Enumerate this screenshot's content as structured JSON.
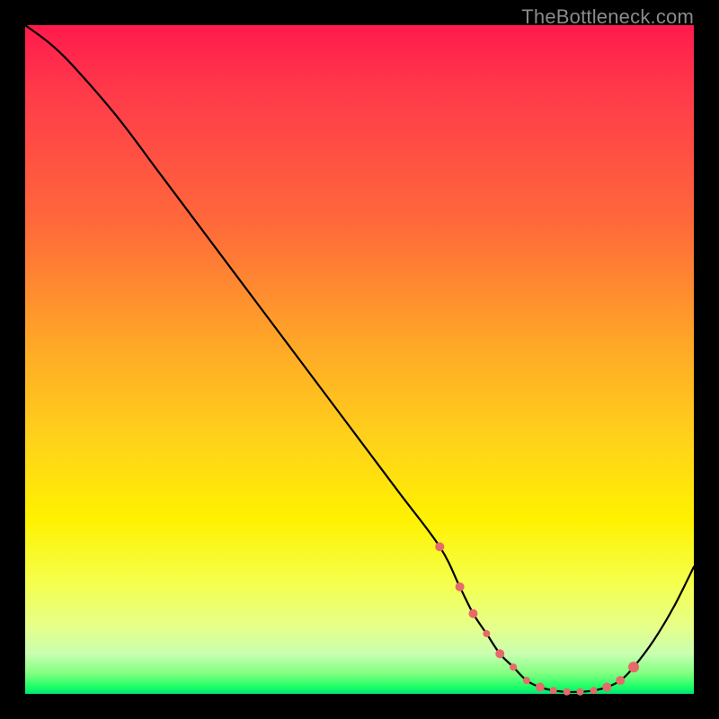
{
  "watermark": "TheBottleneck.com",
  "colors": {
    "background": "#000000",
    "watermark": "#8a8a8a",
    "curve": "#000000",
    "marker_fill": "#e66a6a",
    "marker_stroke": "#c94f4f"
  },
  "chart_data": {
    "type": "line",
    "title": "",
    "xlabel": "",
    "ylabel": "",
    "xlim": [
      0,
      100
    ],
    "ylim": [
      0,
      100
    ],
    "grid": false,
    "legend": false,
    "series": [
      {
        "name": "bottleneck-curve",
        "x": [
          0,
          4,
          8,
          14,
          20,
          26,
          32,
          38,
          44,
          50,
          56,
          62,
          65,
          67,
          69,
          71,
          73,
          75,
          77,
          79,
          81,
          83,
          85,
          87,
          89,
          91,
          94,
          97,
          100
        ],
        "values": [
          100,
          97,
          93,
          86,
          78,
          70,
          62,
          54,
          46,
          38,
          30,
          22,
          16,
          12,
          9,
          6,
          4,
          2,
          1,
          0.5,
          0.3,
          0.3,
          0.5,
          1,
          2,
          4,
          8,
          13,
          19
        ]
      }
    ],
    "markers": {
      "name": "highlighted-points",
      "x": [
        62,
        65,
        67,
        69,
        71,
        73,
        75,
        77,
        79,
        81,
        83,
        85,
        87,
        89,
        91
      ],
      "values": [
        22,
        16,
        12,
        9,
        6,
        4,
        2,
        1,
        0.5,
        0.3,
        0.3,
        0.5,
        1,
        2,
        4
      ],
      "sizes": [
        5,
        5,
        5,
        4,
        5,
        4,
        4,
        5,
        4,
        4,
        4,
        4,
        5,
        5,
        6
      ]
    }
  }
}
